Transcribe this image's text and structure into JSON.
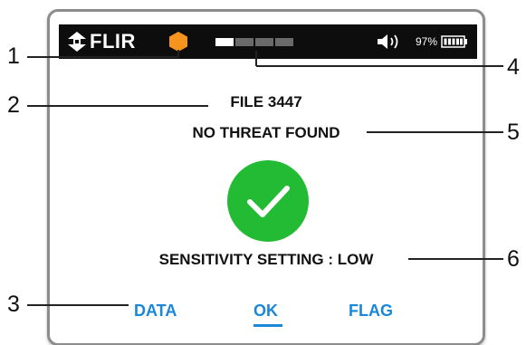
{
  "status_bar": {
    "logo_text": "FLIR",
    "battery_percent": "97%",
    "scan_progress_segments": 4,
    "scan_progress_filled": 1,
    "indicator_color": "#f7941d"
  },
  "screen": {
    "file_label": "FILE 3447",
    "result_text": "NO THREAT FOUND",
    "result_icon": "checkmark-icon",
    "result_color": "#22bb33",
    "sensitivity_text": "SENSITIVITY SETTING : LOW"
  },
  "soft_keys": {
    "left": "DATA",
    "center": "OK",
    "right": "FLAG"
  },
  "callouts": [
    "1",
    "2",
    "3",
    "4",
    "5",
    "6"
  ],
  "accent_color": "#1a87d9"
}
